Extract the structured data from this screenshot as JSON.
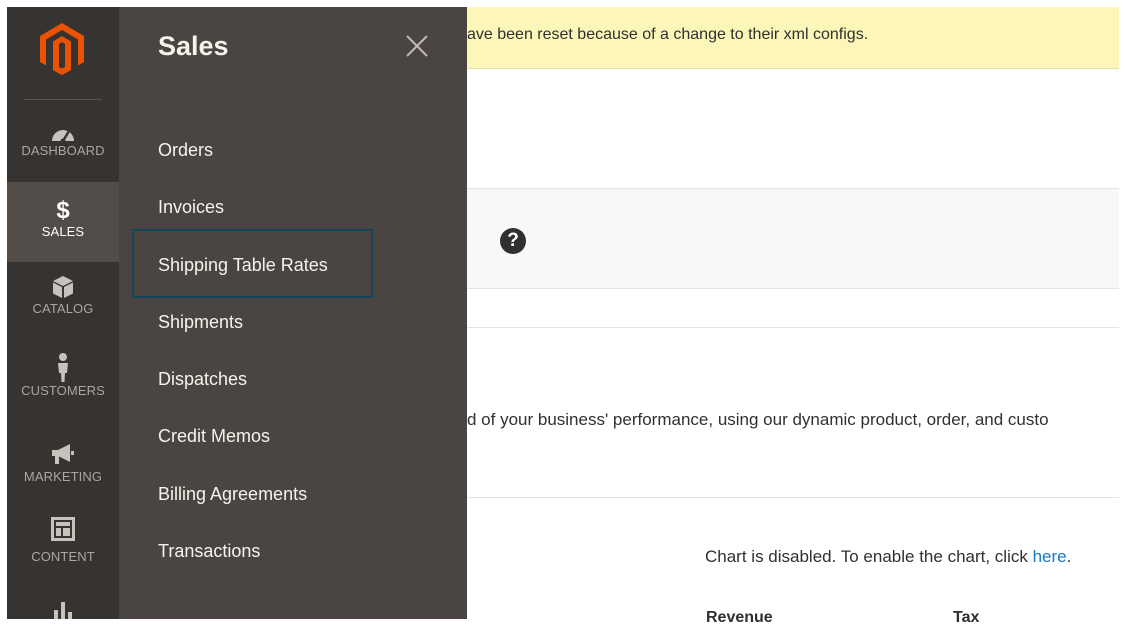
{
  "notice": {
    "text": "ave been reset because of a change to their xml configs."
  },
  "rail": {
    "items": [
      {
        "label": "DASHBOARD",
        "icon": "dashboard-icon"
      },
      {
        "label": "SALES",
        "icon": "dollar-icon"
      },
      {
        "label": "CATALOG",
        "icon": "box-icon"
      },
      {
        "label": "CUSTOMERS",
        "icon": "person-icon"
      },
      {
        "label": "MARKETING",
        "icon": "megaphone-icon"
      },
      {
        "label": "CONTENT",
        "icon": "layout-icon"
      },
      {
        "label": "",
        "icon": "bar-chart-icon"
      }
    ]
  },
  "flyout": {
    "title": "Sales",
    "items": [
      {
        "label": "Orders"
      },
      {
        "label": "Invoices"
      },
      {
        "label": "Shipping Table Rates"
      },
      {
        "label": "Shipments"
      },
      {
        "label": "Dispatches"
      },
      {
        "label": "Credit Memos"
      },
      {
        "label": "Billing Agreements"
      },
      {
        "label": "Transactions"
      }
    ]
  },
  "main": {
    "help_glyph": "?",
    "description": "d of your business' performance, using our dynamic product, order, and custo",
    "chart_note": "Chart is disabled. To enable the chart, click ",
    "chart_link": "here",
    "chart_note_end": ".",
    "columns": {
      "revenue": "Revenue",
      "tax": "Tax"
    }
  },
  "colors": {
    "rail": "#373330",
    "flyout": "#4a4542",
    "accent": "#eb5202",
    "notice": "#fcf7b9",
    "link": "#1979c3"
  }
}
